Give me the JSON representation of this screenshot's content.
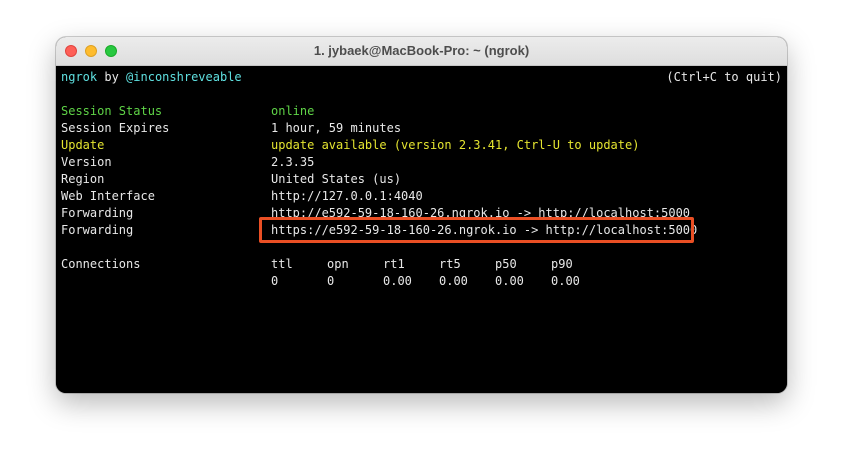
{
  "window": {
    "title": "1. jybaek@MacBook-Pro: ~ (ngrok)"
  },
  "header": {
    "app": "ngrok",
    "by": "by",
    "author": "@inconshreveable",
    "quit_hint": "(Ctrl+C to quit)"
  },
  "session": {
    "status_label": "Session Status",
    "status_value": "online",
    "expires_label": "Session Expires",
    "expires_value": "1 hour, 59 minutes",
    "update_label": "Update",
    "update_value": "update available (version 2.3.41, Ctrl-U to update)",
    "version_label": "Version",
    "version_value": "2.3.35",
    "region_label": "Region",
    "region_value": "United States (us)",
    "web_label": "Web Interface",
    "web_value": "http://127.0.0.1:4040",
    "forwarding_label": "Forwarding",
    "forwarding_http": "http://e592-59-18-160-26.ngrok.io -> http://localhost:5000",
    "forwarding_https": "https://e592-59-18-160-26.ngrok.io -> http://localhost:5000"
  },
  "connections": {
    "label": "Connections",
    "headers": [
      "ttl",
      "opn",
      "rt1",
      "rt5",
      "p50",
      "p90"
    ],
    "values": [
      "0",
      "0",
      "0.00",
      "0.00",
      "0.00",
      "0.00"
    ]
  },
  "colors": {
    "highlight_border": "#ea4f24",
    "status_green": "#5fd447",
    "update_yellow": "#e5e530",
    "header_cyan": "#5fe0e0"
  }
}
